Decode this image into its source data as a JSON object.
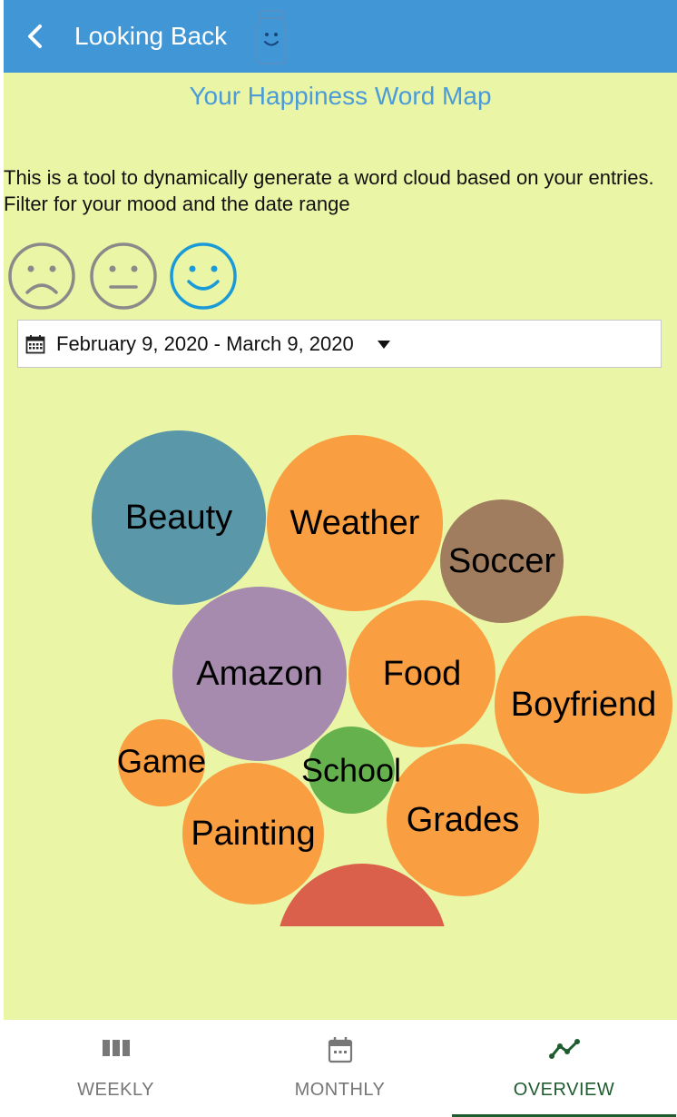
{
  "header": {
    "title": "Looking Back",
    "color": "#4196d6",
    "back_icon": "chevron-left-icon",
    "logo_icon": "smiley-jar-icon"
  },
  "page": {
    "title": "Your Happiness Word Map",
    "description": "This is a tool to dynamically generate a word cloud based on your entries. Filter for your mood and the date range"
  },
  "moods": [
    {
      "name": "sad",
      "icon": "sad-face-icon",
      "selected": false,
      "color": "#8a8a8a"
    },
    {
      "name": "neutral",
      "icon": "neutral-face-icon",
      "selected": false,
      "color": "#8a8a8a"
    },
    {
      "name": "happy",
      "icon": "happy-face-icon",
      "selected": true,
      "color": "#1b9ad8"
    }
  ],
  "date_range": {
    "value": "February 9, 2020 - March 9, 2020",
    "icon": "calendar-icon"
  },
  "word_cloud": [
    {
      "word": "Beauty",
      "color": "#5a97a8"
    },
    {
      "word": "Weather",
      "color": "#f99e41"
    },
    {
      "word": "Soccer",
      "color": "#a07d5e"
    },
    {
      "word": "Amazon",
      "color": "#a68baf"
    },
    {
      "word": "Food",
      "color": "#f99e41"
    },
    {
      "word": "Boyfriend",
      "color": "#f99e41"
    },
    {
      "word": "Game",
      "color": "#f99e41"
    },
    {
      "word": "School",
      "color": "#64b14e"
    },
    {
      "word": "Painting",
      "color": "#f99e41"
    },
    {
      "word": "Grades",
      "color": "#f99e41"
    },
    {
      "word": "",
      "color": "#da604b"
    }
  ],
  "tabs": [
    {
      "label": "WEEKLY",
      "icon": "bar-columns-icon",
      "active": false
    },
    {
      "label": "MONTHLY",
      "icon": "calendar-icon",
      "active": false
    },
    {
      "label": "OVERVIEW",
      "icon": "line-chart-icon",
      "active": true
    }
  ]
}
